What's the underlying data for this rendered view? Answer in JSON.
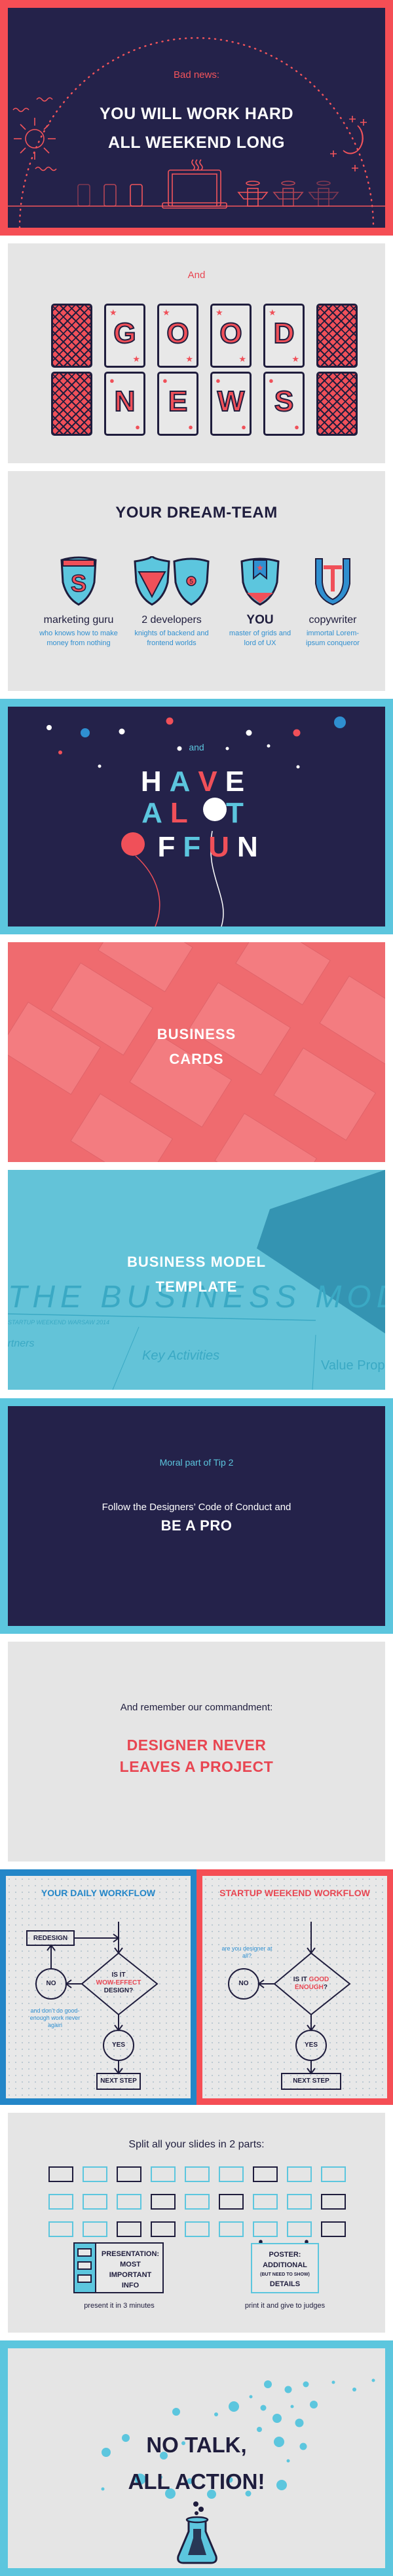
{
  "colors": {
    "navy": "#24224a",
    "red": "#f54e55",
    "cyan": "#5cc6de",
    "blue": "#2f8fd0",
    "light_gray": "#e5e5e5"
  },
  "slide_bad_news": {
    "label": "Bad news:",
    "title_line1": "YOU WILL WORK HARD",
    "title_line2": "ALL WEEKEND LONG",
    "icons": [
      "sun-icon",
      "moon-icon",
      "soda-can-icon",
      "laptop-icon",
      "coffee-cup-icon"
    ]
  },
  "slide_good_news": {
    "label": "And",
    "row1": [
      "",
      "G",
      "O",
      "O",
      "D",
      ""
    ],
    "row2": [
      "",
      "N",
      "E",
      "W",
      "S",
      ""
    ],
    "row1_pip": "★",
    "row2_pip": "●"
  },
  "slide_dream_team": {
    "title": "YOUR DREAM-TEAM",
    "members": [
      {
        "role": "marketing guru",
        "desc": "who knows how to make money from nothing",
        "icon": "shield-dollar-icon"
      },
      {
        "role": "2 developers",
        "desc": "knights of backend and frontend worlds",
        "icon": "shield-ruby-html5-icon"
      },
      {
        "role": "YOU",
        "desc": "master of grids and lord of UX",
        "icon": "shield-star-icon"
      },
      {
        "role": "copywriter",
        "desc": "immortal Lorem-ipsum conqueror",
        "icon": "shield-t-icon"
      }
    ]
  },
  "slide_fun": {
    "label": "and",
    "line1": [
      "H",
      "A",
      "V",
      "E"
    ],
    "line2": [
      "A",
      "L",
      "O",
      "T"
    ],
    "line3": [
      "O",
      "F",
      " ",
      "F",
      "U",
      "N"
    ]
  },
  "slide_business_cards": {
    "title_line1": "BUSINESS",
    "title_line2": "CARDS"
  },
  "slide_business_model": {
    "title_line1": "BUSINESS MODEL",
    "title_line2": "TEMPLATE",
    "background_text": "THE BUSINESS MODEL",
    "background_sub": "STARTUP WEEKEND WARSAW 2014",
    "background_cells": [
      "Partners",
      "Key Activities",
      "Value Prop"
    ]
  },
  "slide_be_pro": {
    "label": "Moral part of Tip 2",
    "line1": "Follow the Designers’ Code of Conduct and",
    "line2": "BE A PRO"
  },
  "slide_commandment": {
    "line1": "And remember our commandment:",
    "line2a": "DESIGNER NEVER",
    "line2b": "LEAVES A PROJECT"
  },
  "workflow_daily": {
    "title": "YOUR DAILY WORKFLOW",
    "redesign": "REDESIGN",
    "question_1": "IS IT",
    "question_2": "WOW-EFFECT",
    "question_3": "DESIGN?",
    "no": "NO",
    "yes": "YES",
    "next": "NEXT STEP",
    "note": "and don’t do good-enough work never again"
  },
  "workflow_startup": {
    "title": "STARTUP WEEKEND WORKFLOW",
    "question_1": "IS IT",
    "question_2": "GOOD",
    "question_3": "ENOUGH",
    "question_4": "?",
    "no": "NO",
    "yes": "YES",
    "next": "NEXT STEP",
    "note": "are you designer at all?"
  },
  "slide_split": {
    "title": "Split all your slides in 2 parts:",
    "grid": [
      [
        "dark",
        "light",
        "dark",
        "light",
        "light",
        "light",
        "dark",
        "light",
        "light"
      ],
      [
        "light",
        "light",
        "light",
        "dark",
        "light",
        "dark",
        "light",
        "light",
        "dark"
      ],
      [
        "light",
        "light",
        "dark",
        "dark",
        "light",
        "light",
        "light",
        "light",
        "dark"
      ]
    ],
    "presentation_lines": [
      "PRESENTATION:",
      "MOST",
      "IMPORTANT",
      "INFO"
    ],
    "poster_line1": "POSTER:",
    "poster_line2": "ADDITIONAL",
    "poster_small": "(BUT NEED TO SHOW)",
    "poster_line3": "DETAILS",
    "caption_left": "present it in 3 minutes",
    "caption_right": "print it and give to judges"
  },
  "slide_action": {
    "title_line1": "NO TALK,",
    "title_line2": "ALL ACTION!",
    "icon": "flask-icon"
  }
}
